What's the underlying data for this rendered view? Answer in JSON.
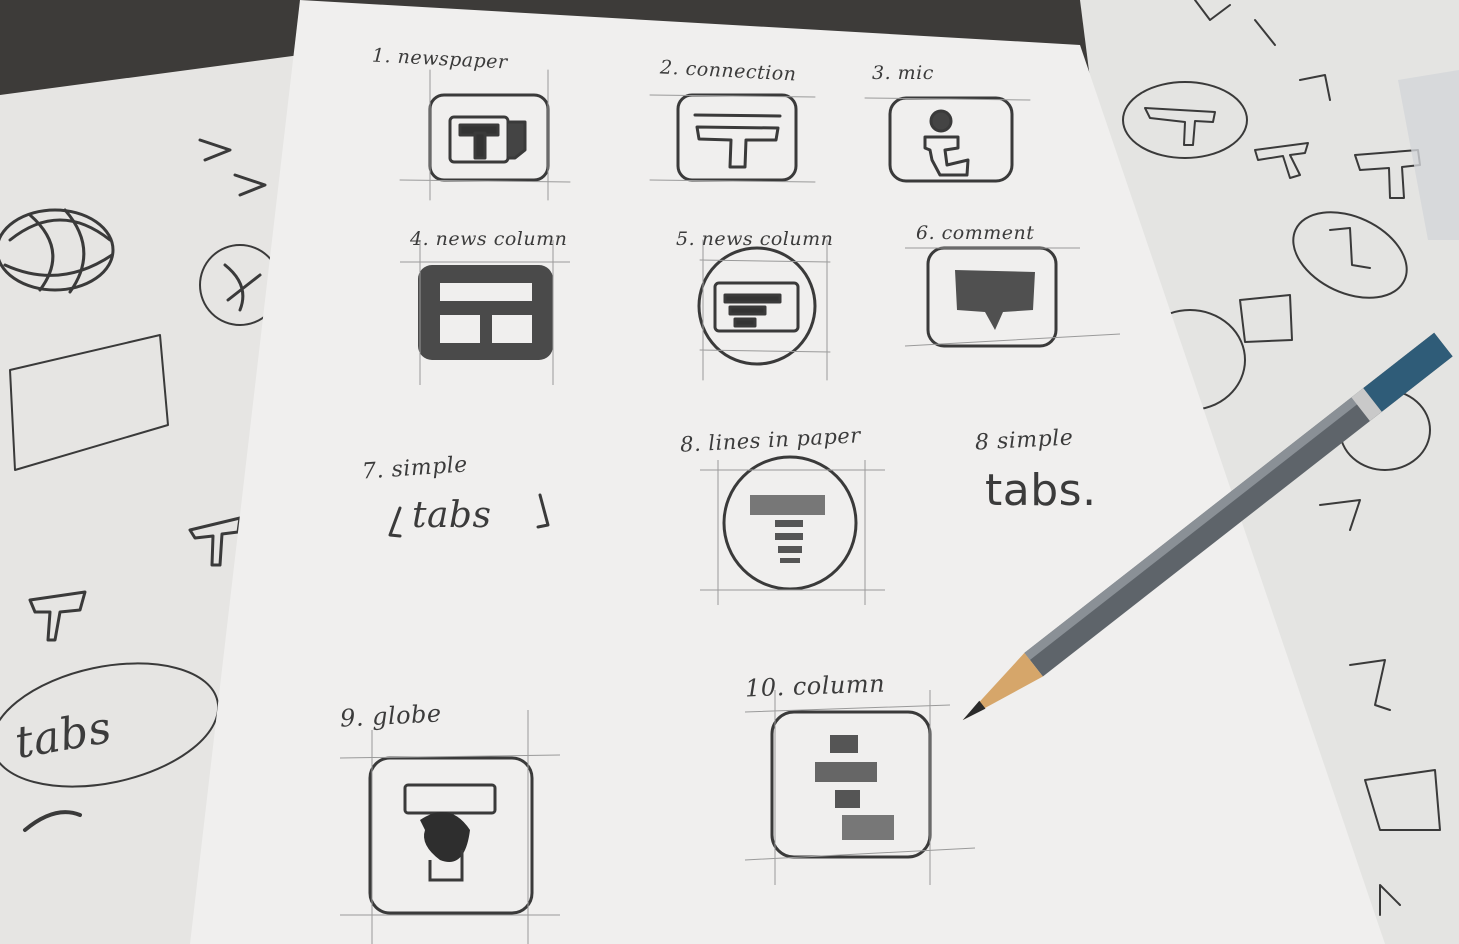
{
  "photo_description_text": {
    "sketch_labels": [
      "1. newspaper",
      "2. connection",
      "3. mic",
      "4. news column",
      "5. news column",
      "6. comment",
      "7. simple",
      "tabs",
      "8. lines in paper",
      "8 simple",
      "tabs.",
      "9. globe",
      "10. column"
    ],
    "left_sheet_text": "tabs"
  },
  "colors": {
    "background": "#3d3b39",
    "paper": "#ecebea",
    "pencil_graphite": "#3a3a3a",
    "pencil_body": "#5e646a",
    "pencil_cap": "#2f5c78",
    "pencil_wood": "#d6a66a"
  }
}
